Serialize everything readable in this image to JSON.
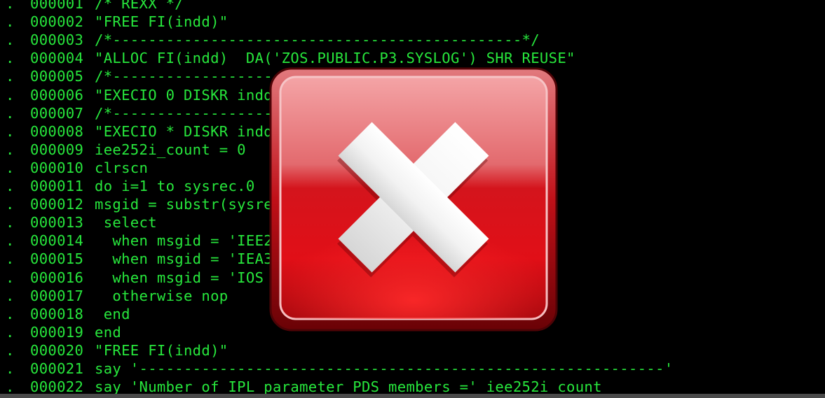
{
  "terminal": {
    "lines": [
      {
        "dot": ".",
        "num": "000001",
        "code": "/* REXX */"
      },
      {
        "dot": ".",
        "num": "000002",
        "code": "\"FREE FI(indd)\""
      },
      {
        "dot": ".",
        "num": "000003",
        "code": "/*----------------------------------------------*/"
      },
      {
        "dot": ".",
        "num": "000004",
        "code": "\"ALLOC FI(indd)  DA('ZOS.PUBLIC.P3.SYSLOG') SHR REUSE\""
      },
      {
        "dot": ".",
        "num": "000005",
        "code": "/*----------------------------------------------*/"
      },
      {
        "dot": ".",
        "num": "000006",
        "code": "\"EXECIO 0 DISKR indd"
      },
      {
        "dot": ".",
        "num": "000007",
        "code": "/*----------------------------------------------*/"
      },
      {
        "dot": ".",
        "num": "000008",
        "code": "\"EXECIO * DISKR indd"
      },
      {
        "dot": ".",
        "num": "000009",
        "code": "iee252i_count = 0"
      },
      {
        "dot": ".",
        "num": "000010",
        "code": "clrscn"
      },
      {
        "dot": ".",
        "num": "000011",
        "code": "do i=1 to sysrec.0"
      },
      {
        "dot": ".",
        "num": "000012",
        "code": "msgid = substr(sysrec"
      },
      {
        "dot": ".",
        "num": "000013",
        "code": " select"
      },
      {
        "dot": ".",
        "num": "000014",
        "code": "  when msgid = 'IEE2"
      },
      {
        "dot": ".",
        "num": "000015",
        "code": "  when msgid = 'IEA3"
      },
      {
        "dot": ".",
        "num": "000016",
        "code": "  when msgid = 'IOS"
      },
      {
        "dot": ".",
        "num": "000017",
        "code": "  otherwise nop"
      },
      {
        "dot": ".",
        "num": "000018",
        "code": " end"
      },
      {
        "dot": ".",
        "num": "000019",
        "code": "end"
      },
      {
        "dot": ".",
        "num": "000020",
        "code": "\"FREE FI(indd)\""
      },
      {
        "dot": ".",
        "num": "000021",
        "code": "say '-----------------------------------------------------------'"
      },
      {
        "dot": ".",
        "num": "000022",
        "code": "say 'Number of IPL parameter PDS members =' iee252i_count"
      }
    ]
  },
  "overlay": {
    "icon": "error-x-icon"
  },
  "colors": {
    "text": "#27e63c",
    "background": "#000000",
    "icon_red": "#d6141c",
    "icon_white": "#ffffff"
  }
}
